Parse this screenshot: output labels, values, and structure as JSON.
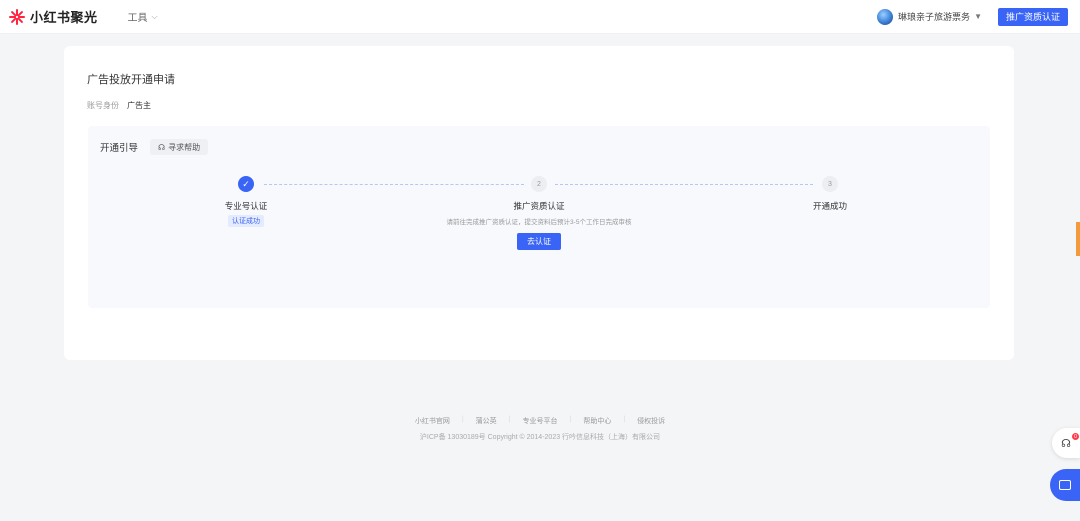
{
  "header": {
    "brand": "小红书聚光",
    "tools_menu": "工具",
    "account_name": "琳琅亲子旅游票务",
    "cert_button": "推广资质认证"
  },
  "page": {
    "title": "广告投放开通申请",
    "identity_label": "账号身份",
    "identity_value": "广告主"
  },
  "guide": {
    "title": "开通引导",
    "help_button": "寻求帮助",
    "steps": [
      {
        "index": "1",
        "label": "专业号认证",
        "status": "done",
        "badge": "认证成功"
      },
      {
        "index": "2",
        "label": "推广资质认证",
        "status": "current",
        "description": "请前往完成推广资质认证，提交资料后预计3-5个工作日完成审核",
        "action": "去认证"
      },
      {
        "index": "3",
        "label": "开通成功",
        "status": "todo"
      }
    ]
  },
  "footer": {
    "links": [
      "小红书官网",
      "蒲公英",
      "专业号平台",
      "帮助中心",
      "侵权投诉"
    ],
    "copyright": "沪ICP备 13030189号 Copyright © 2014-2023 行吟信息科技（上海）有限公司"
  },
  "floating": {
    "support_badge": "0"
  },
  "icons": {
    "check": "check-icon",
    "chevron": "chevron-down-icon",
    "headset": "headset-icon",
    "chat": "chat-icon"
  },
  "colors": {
    "primary": "#3a64f6",
    "brand_red": "#ff2442",
    "badge_bg": "#e5ebff"
  }
}
